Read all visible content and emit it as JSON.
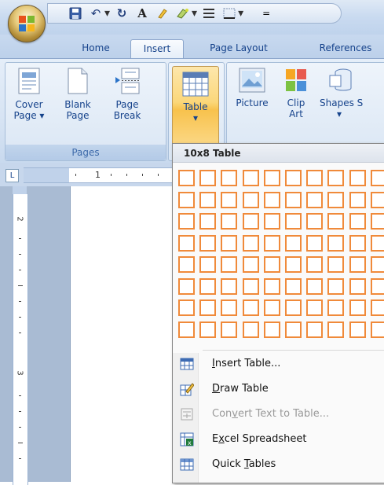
{
  "qat": {
    "undo_glyph": "↶",
    "repeat_glyph": "↻",
    "font_glyph": "A",
    "dropdown_glyph": "▾",
    "customize_glyph": "="
  },
  "tabs": [
    {
      "label": "Home"
    },
    {
      "label": "Insert",
      "active": true
    },
    {
      "label": "Page Layout"
    },
    {
      "label": "References"
    }
  ],
  "ribbon": {
    "pages_group": {
      "label": "Pages",
      "buttons": [
        {
          "line1": "Cover",
          "line2": "Page ▾"
        },
        {
          "line1": "Blank",
          "line2": "Page"
        },
        {
          "line1": "Page",
          "line2": "Break"
        }
      ]
    },
    "tables_group": {
      "table_button": {
        "line1": "Table",
        "line2": "▾"
      }
    },
    "illustrations_group": {
      "buttons": [
        {
          "line1": "Picture",
          "line2": ""
        },
        {
          "line1": "Clip",
          "line2": "Art"
        },
        {
          "line1": "Shapes S",
          "line2": "▾"
        }
      ]
    }
  },
  "ruler": {
    "corner_glyph": "L",
    "horizontal_number": "1",
    "vertical_numbers": [
      "2",
      "3"
    ]
  },
  "dropdown": {
    "header": "10x8 Table",
    "grid": {
      "columns": 10,
      "rows": 8,
      "highlight_color": "#f08a3a"
    },
    "menu": [
      {
        "pre": "",
        "u": "I",
        "post": "nsert Table...",
        "icon": "insert-table-icon",
        "enabled": true
      },
      {
        "pre": "",
        "u": "D",
        "post": "raw Table",
        "icon": "draw-table-icon",
        "enabled": true
      },
      {
        "pre": "Con",
        "u": "v",
        "post": "ert Text to Table...",
        "icon": "convert-text-icon",
        "enabled": false
      },
      {
        "pre": "E",
        "u": "x",
        "post": "cel Spreadsheet",
        "icon": "excel-spreadsheet-icon",
        "enabled": true
      },
      {
        "pre": "Quick ",
        "u": "T",
        "post": "ables",
        "icon": "quick-tables-icon",
        "enabled": true,
        "submenu_glyph": "▸"
      }
    ]
  }
}
